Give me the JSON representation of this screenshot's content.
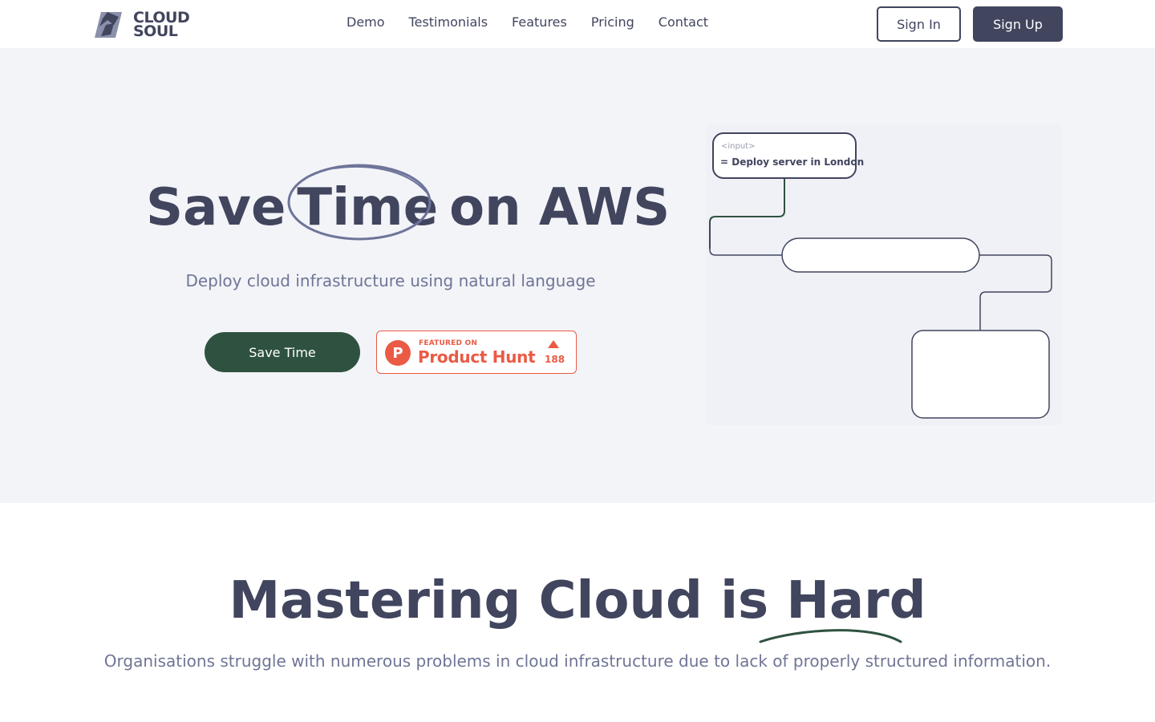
{
  "brand": {
    "logo_line1": "CLOUD",
    "logo_line2": "SOUL",
    "logo_icon": "cloudsoul-logo-icon"
  },
  "nav": {
    "items": [
      "Demo",
      "Testimonials",
      "Features",
      "Pricing",
      "Contact"
    ]
  },
  "auth": {
    "sign_in": "Sign In",
    "sign_up": "Sign Up"
  },
  "hero": {
    "title_part1": "Save",
    "title_highlight": "Time",
    "title_part2": "on AWS",
    "subtitle": "Deploy cloud infrastructure using natural language",
    "cta": "Save Time"
  },
  "product_hunt": {
    "featured": "FEATURED ON",
    "name": "Product Hunt",
    "logo_letter": "P",
    "upvotes": "188"
  },
  "diagram": {
    "input_tag": "<input>",
    "input_text": "= Deploy server in London"
  },
  "section2": {
    "title_part1": "Mastering Cloud is",
    "title_highlight": "Hard",
    "subtitle": "Organisations struggle with numerous problems in cloud infrastructure due to lack of properly structured information."
  },
  "colors": {
    "primary": "#41455e",
    "accent_green": "#2f5240",
    "product_hunt": "#ea5a45",
    "hero_bg": "#f3f4f8",
    "muted_text": "#6f7596"
  }
}
